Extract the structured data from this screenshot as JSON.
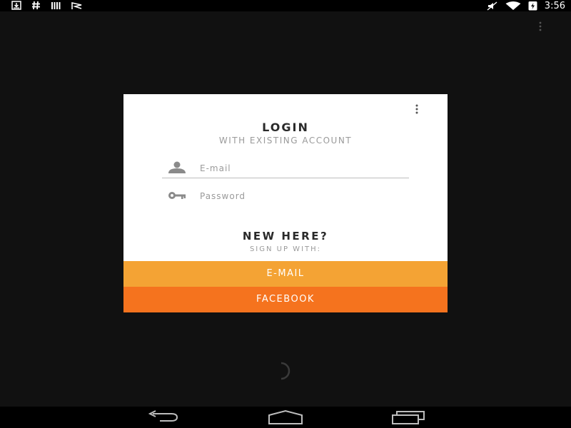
{
  "status_bar": {
    "time": "3:56",
    "icons_left": [
      "download-icon",
      "hash-icon",
      "barcode-icon",
      "notification-flag-icon"
    ],
    "icons_right": [
      "mute-icon",
      "wifi-icon",
      "battery-icon"
    ]
  },
  "login": {
    "title": "LOGIN",
    "subtitle": "WITH EXISTING ACCOUNT",
    "email_placeholder": "E-mail",
    "password_placeholder": "Password"
  },
  "signup": {
    "title": "NEW HERE?",
    "subtitle": "SIGN UP WITH:",
    "email_button": "E-MAIL",
    "facebook_button": "FACEBOOK"
  },
  "colors": {
    "email_button": "#f4a334",
    "facebook_button": "#f5731e",
    "background": "#111111",
    "card": "#ffffff"
  },
  "nav_bar": {
    "icons": [
      "back-icon",
      "home-icon",
      "recents-icon"
    ]
  }
}
